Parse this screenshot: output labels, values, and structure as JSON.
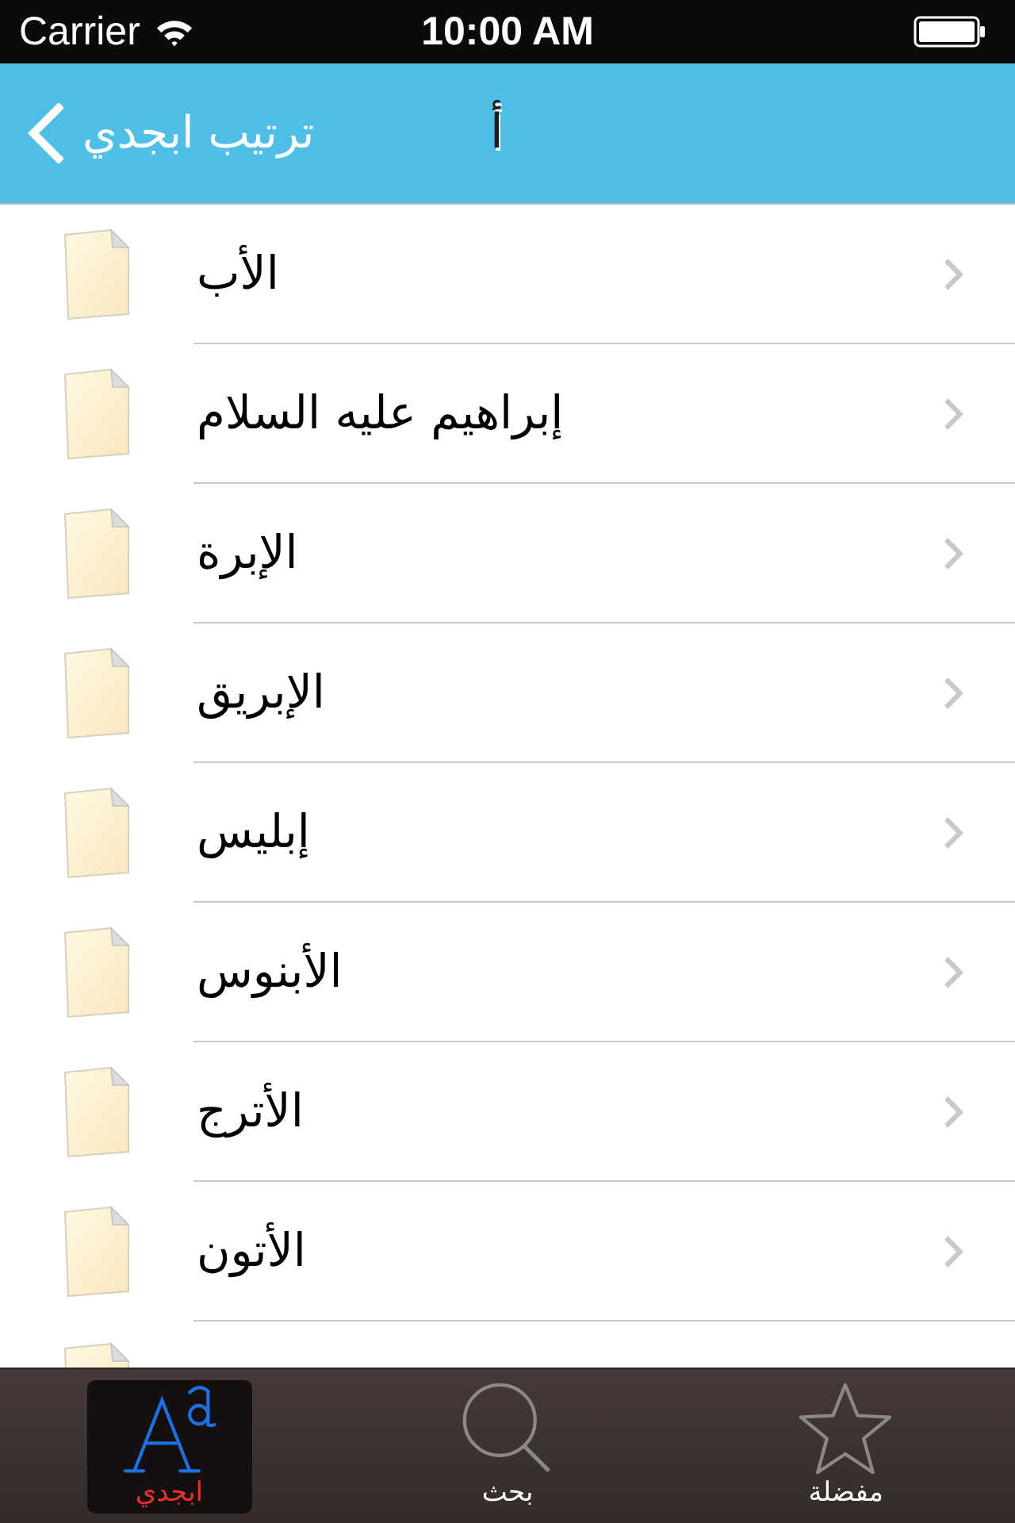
{
  "status_bar": {
    "carrier": "Carrier",
    "time": "10:00 AM"
  },
  "nav_bar": {
    "back_label": "ترتيب ابجدي",
    "title": "أ"
  },
  "list": {
    "rows": [
      {
        "text": "الأب"
      },
      {
        "text": "إبراهيم عليه السلام"
      },
      {
        "text": "الإبرة"
      },
      {
        "text": "الإبريق"
      },
      {
        "text": "إبليس"
      },
      {
        "text": "الأبنوس"
      },
      {
        "text": "الأترج"
      },
      {
        "text": "الأتون"
      }
    ],
    "more_below": true
  },
  "tab_bar": {
    "tabs": [
      {
        "kind": "favorites",
        "label": "مفضلة",
        "selected": false
      },
      {
        "kind": "search",
        "label": "بحث",
        "selected": false
      },
      {
        "kind": "alphabet",
        "label": "ابجدي",
        "selected": true
      }
    ]
  }
}
